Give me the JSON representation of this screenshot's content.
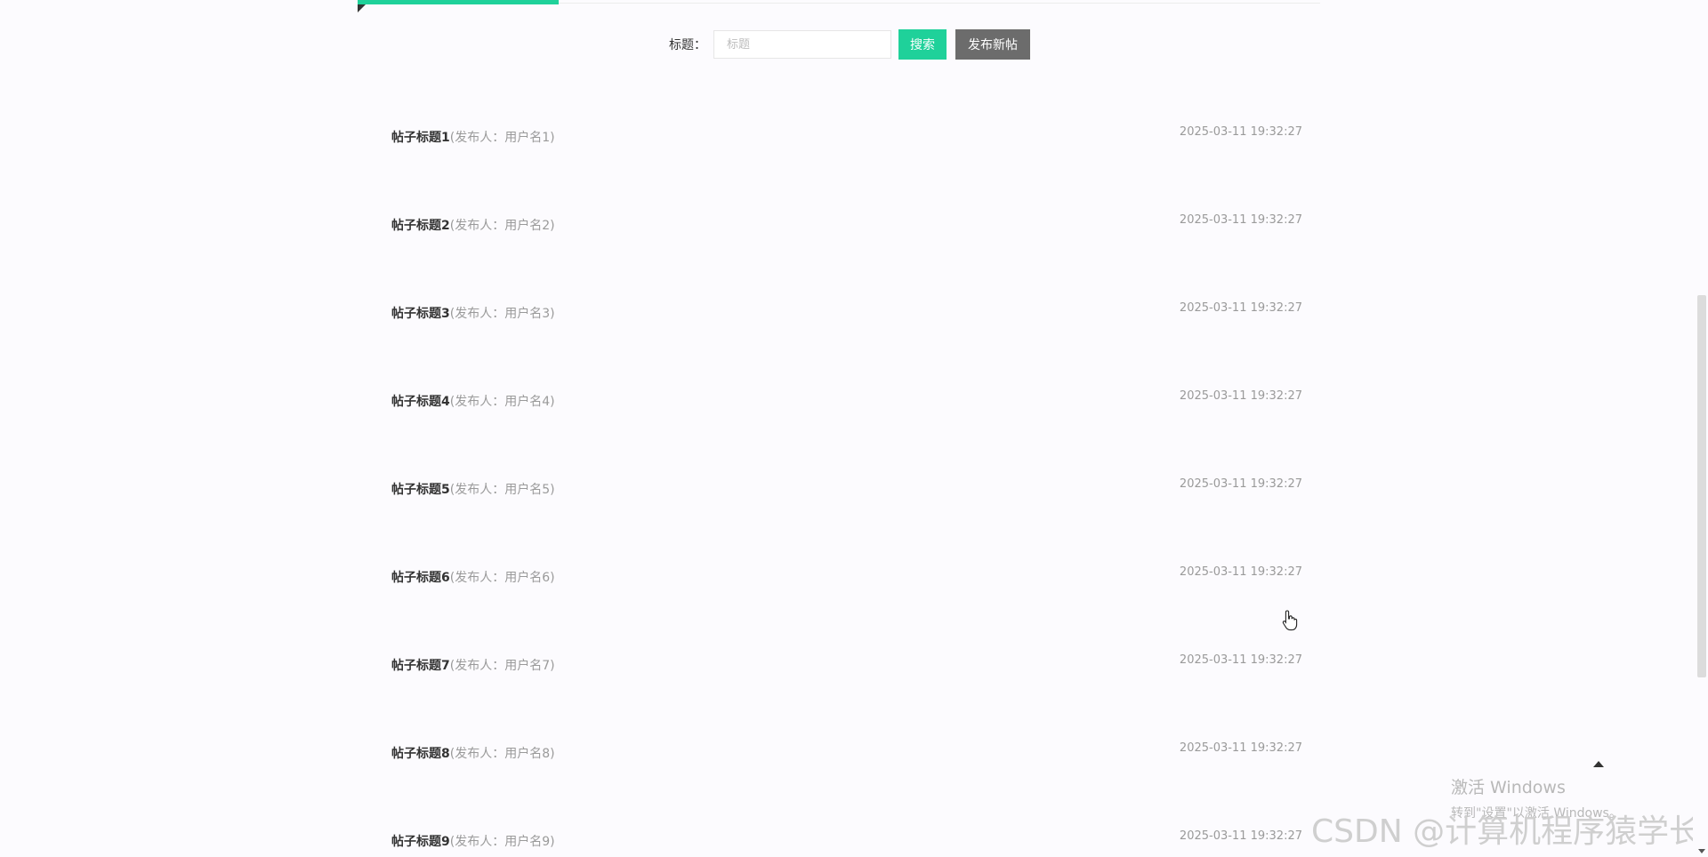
{
  "search": {
    "label": "标题：",
    "placeholder": "标题",
    "value": "",
    "search_button": "搜索",
    "publish_button": "发布新帖"
  },
  "posts": [
    {
      "title": "帖子标题1",
      "meta": "(发布人：用户名1)",
      "time": "2025-03-11 19:32:27"
    },
    {
      "title": "帖子标题2",
      "meta": "(发布人：用户名2)",
      "time": "2025-03-11 19:32:27"
    },
    {
      "title": "帖子标题3",
      "meta": "(发布人：用户名3)",
      "time": "2025-03-11 19:32:27"
    },
    {
      "title": "帖子标题4",
      "meta": "(发布人：用户名4)",
      "time": "2025-03-11 19:32:27"
    },
    {
      "title": "帖子标题5",
      "meta": "(发布人：用户名5)",
      "time": "2025-03-11 19:32:27"
    },
    {
      "title": "帖子标题6",
      "meta": "(发布人：用户名6)",
      "time": "2025-03-11 19:32:27"
    },
    {
      "title": "帖子标题7",
      "meta": "(发布人：用户名7)",
      "time": "2025-03-11 19:32:27"
    },
    {
      "title": "帖子标题8",
      "meta": "(发布人：用户名8)",
      "time": "2025-03-11 19:32:27"
    },
    {
      "title": "帖子标题9",
      "meta": "(发布人：用户名9)",
      "time": "2025-03-11 19:32:27"
    }
  ],
  "watermarks": {
    "windows_line1": "激活 Windows",
    "windows_line2": "转到\"设置\"以激活 Windows。",
    "csdn": "CSDN @计算机程序猿学长"
  },
  "colors": {
    "accent": "#1fd19a",
    "publish": "#6c6c6c"
  },
  "icons": {
    "cursor": "hand-pointer-icon",
    "back_to_top": "caret-up-icon"
  }
}
